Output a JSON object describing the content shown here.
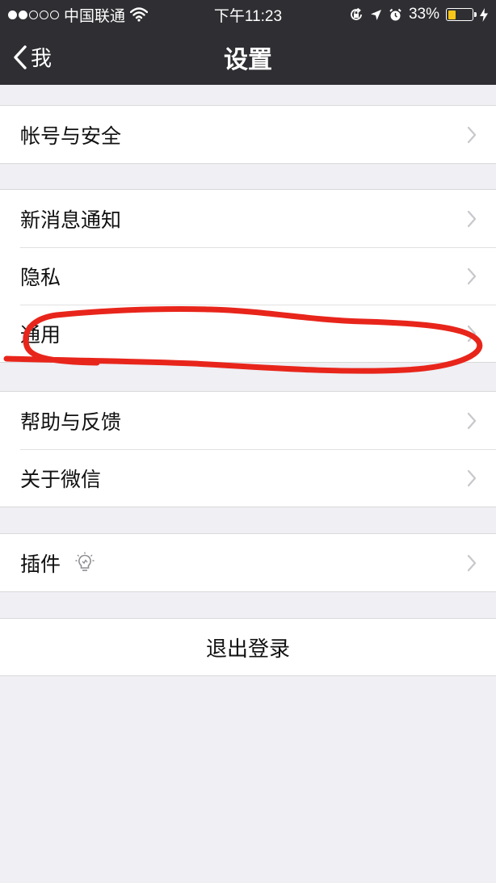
{
  "status_bar": {
    "carrier": "中国联通",
    "time": "下午11:23",
    "battery_percent": "33%",
    "battery_level": 0.33,
    "signal_bars_filled": 2,
    "signal_bars_total": 5,
    "icons": [
      "wifi-icon",
      "rotation-lock-icon",
      "location-arrow-icon",
      "alarm-icon",
      "battery-icon",
      "charging-bolt-icon"
    ]
  },
  "nav": {
    "back_label": "我",
    "title": "设置"
  },
  "groups": [
    {
      "items": [
        {
          "label": "帐号与安全"
        }
      ]
    },
    {
      "items": [
        {
          "label": "新消息通知"
        },
        {
          "label": "隐私"
        },
        {
          "label": "通用"
        }
      ]
    },
    {
      "items": [
        {
          "label": "帮助与反馈"
        },
        {
          "label": "关于微信"
        }
      ]
    },
    {
      "items": [
        {
          "label": "插件",
          "icon": "lightbulb-icon"
        }
      ]
    }
  ],
  "logout_label": "退出登录",
  "colors": {
    "bar_background": "#2f2f33",
    "page_background": "#efeff4",
    "cell_background": "#ffffff",
    "battery_fill": "#f5c518",
    "annotation_stroke": "#e8251b",
    "chevron": "#c7c7cc"
  }
}
